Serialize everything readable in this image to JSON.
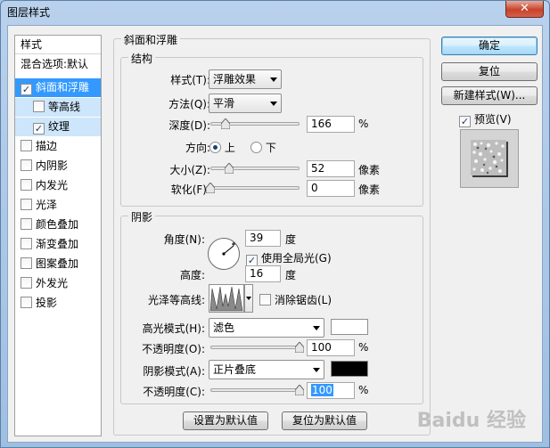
{
  "window": {
    "title": "图层样式",
    "close_label": "✕"
  },
  "style_list": {
    "header": "样式",
    "blend_options": "混合选项:默认",
    "items": [
      {
        "label": "斜面和浮雕",
        "checked": "✓"
      },
      {
        "label": "等高线",
        "checked": ""
      },
      {
        "label": "纹理",
        "checked": "✓"
      },
      {
        "label": "描边",
        "checked": ""
      },
      {
        "label": "内阴影",
        "checked": ""
      },
      {
        "label": "内发光",
        "checked": ""
      },
      {
        "label": "光泽",
        "checked": ""
      },
      {
        "label": "颜色叠加",
        "checked": ""
      },
      {
        "label": "渐变叠加",
        "checked": ""
      },
      {
        "label": "图案叠加",
        "checked": ""
      },
      {
        "label": "外发光",
        "checked": ""
      },
      {
        "label": "投影",
        "checked": ""
      }
    ]
  },
  "bevel": {
    "title": "斜面和浮雕",
    "structure": {
      "title": "结构",
      "style_label": "样式(T):",
      "style_value": "浮雕效果",
      "technique_label": "方法(Q):",
      "technique_value": "平滑",
      "depth_label": "深度(D):",
      "depth_value": "166",
      "depth_unit": "%",
      "depth_level": 0.166,
      "direction_label": "方向:",
      "direction_up": "上",
      "direction_down": "下",
      "size_label": "大小(Z):",
      "size_value": "52",
      "size_unit": "像素",
      "size_level": 0.21,
      "soften_label": "软化(F):",
      "soften_value": "0",
      "soften_unit": "像素",
      "soften_level": 0
    },
    "shading": {
      "title": "阴影",
      "angle_label": "角度(N):",
      "angle_value": "39",
      "angle_unit": "度",
      "global_light_label": "使用全局光(G)",
      "global_light_checked": "✓",
      "altitude_label": "高度:",
      "altitude_value": "16",
      "altitude_unit": "度",
      "gloss_label": "光泽等高线:",
      "antialias_label": "消除锯齿(L)",
      "antialias_checked": "",
      "highlight_mode_label": "高光模式(H):",
      "highlight_mode_value": "滤色",
      "highlight_color": "#ffffff",
      "highlight_opacity_label": "不透明度(O):",
      "highlight_opacity_value": "100",
      "highlight_opacity_level": 1.0,
      "shadow_mode_label": "阴影模式(A):",
      "shadow_mode_value": "正片叠底",
      "shadow_color": "#000000",
      "shadow_opacity_label": "不透明度(C):",
      "shadow_opacity_value": "100",
      "shadow_opacity_level": 1.0,
      "percent": "%"
    },
    "make_default": "设置为默认值",
    "reset_default": "复位为默认值"
  },
  "buttons": {
    "ok": "确定",
    "reset": "复位",
    "new_style": "新建样式(W)...",
    "preview_label": "预览(V)",
    "preview_checked": "✓"
  },
  "watermark": "Baidu 经验"
}
